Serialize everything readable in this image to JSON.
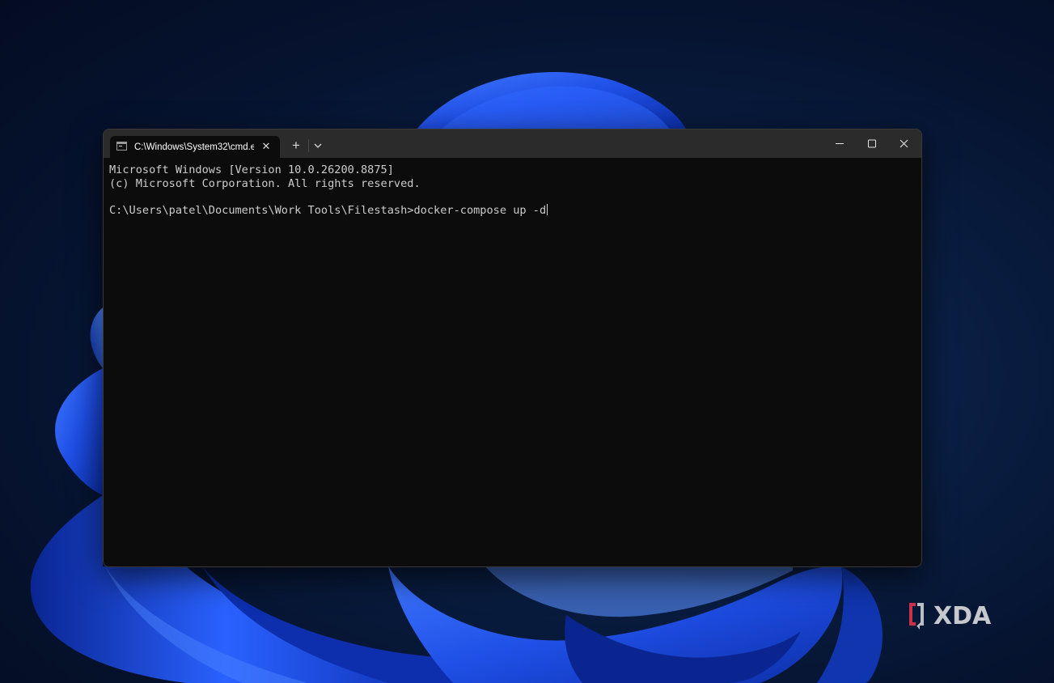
{
  "desktop": {
    "watermark_text": "XDA",
    "colors": {
      "accent_blue": "#1f52e8",
      "watermark_red": "#e2344d"
    }
  },
  "window": {
    "tab": {
      "icon": "terminal-icon",
      "title": "C:\\Windows\\System32\\cmd.e",
      "close_icon": "close-icon"
    },
    "new_tab_label": "+",
    "dropdown_icon": "chevron-down-icon",
    "controls": {
      "minimize_icon": "minimize-icon",
      "maximize_icon": "maximize-icon",
      "close_icon": "close-icon"
    }
  },
  "terminal": {
    "lines": [
      "Microsoft Windows [Version 10.0.26200.8875]",
      "(c) Microsoft Corporation. All rights reserved.",
      "",
      "C:\\Users\\patel\\Documents\\Work Tools\\Filestash>docker-compose up -d"
    ],
    "colors": {
      "background": "#0c0c0c",
      "foreground": "#cccccc"
    }
  }
}
